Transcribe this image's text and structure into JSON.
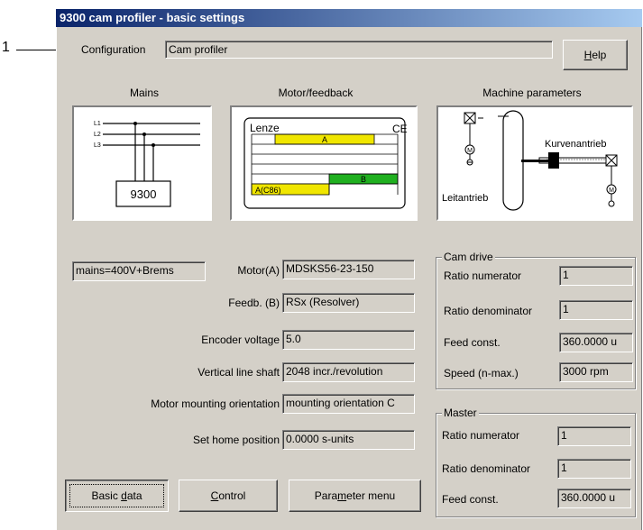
{
  "callout": {
    "number": "1"
  },
  "window": {
    "title": "9300 cam profiler - basic settings"
  },
  "configuration": {
    "label": "Configuration",
    "value": "Cam profiler"
  },
  "help_button": {
    "label": "Help"
  },
  "sections": {
    "mains": "Mains",
    "motor_feedback": "Motor/feedback",
    "machine_parameters": "Machine parameters"
  },
  "mains_diagram": {
    "lines": [
      "L1",
      "L2",
      "L3"
    ],
    "unit": "9300"
  },
  "motor_plate": {
    "brand": "Lenze",
    "mark": "CE",
    "cell_a": "A",
    "cell_b": "B",
    "cell_ac86": "A(C86)"
  },
  "machine_diagram": {
    "right_label": "Kurvenantrieb",
    "left_label": "Leitantrieb",
    "motor_symbol": "M"
  },
  "mains_value": "mains=400V+Brems",
  "fields": [
    {
      "label": "Motor(A)",
      "value": "MDSKS56-23-150"
    },
    {
      "label": "Feedb. (B)",
      "value": "RSx (Resolver)"
    },
    {
      "label": "Encoder voltage",
      "value": "5.0"
    },
    {
      "label": "Vertical line shaft",
      "value": "2048 incr./revolution"
    },
    {
      "label": "Motor mounting orientation",
      "value": "mounting orientation C"
    },
    {
      "label": "Set home position",
      "value": "0.0000 s-units"
    }
  ],
  "cam_drive": {
    "title": "Cam drive",
    "rows": [
      {
        "label": "Ratio numerator",
        "value": "1"
      },
      {
        "label": "Ratio denominator",
        "value": "1"
      },
      {
        "label": "Feed const.",
        "value": "360.0000 u"
      },
      {
        "label": "Speed (n-max.)",
        "value": "3000 rpm"
      }
    ]
  },
  "master": {
    "title": "Master",
    "rows": [
      {
        "label": "Ratio numerator",
        "value": "1"
      },
      {
        "label": "Ratio denominator",
        "value": "1"
      },
      {
        "label": "Feed const.",
        "value": "360.0000 u"
      }
    ]
  },
  "buttons": {
    "basic_data": "Basic data",
    "control": "Control",
    "parameter_menu": "Parameter menu"
  }
}
